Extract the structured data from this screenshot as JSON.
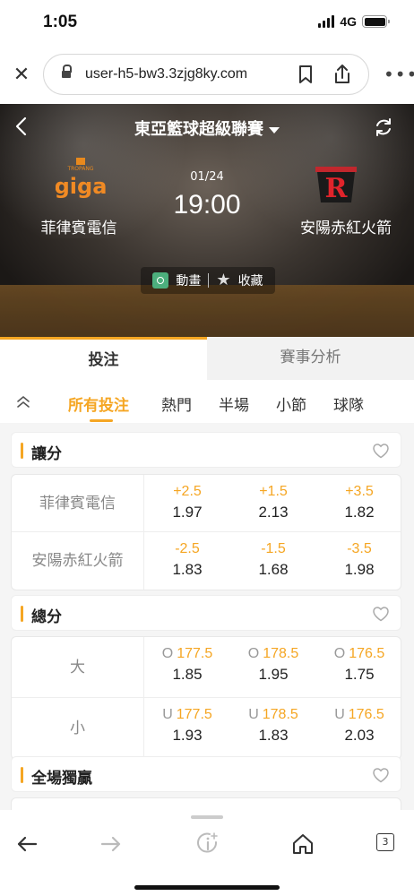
{
  "status_bar": {
    "time": "1:05",
    "network": "4G"
  },
  "browser": {
    "url": "user-h5-bw3.3zjg8ky.com",
    "tab_count": "3"
  },
  "match": {
    "league": "東亞籃球超級聯賽",
    "date": "01/24",
    "time": "19:00",
    "home_team": "菲律賓電信",
    "away_team": "安陽赤紅火箭",
    "home_logo_text": "giga",
    "home_logo_subtext": "TROPANG",
    "away_logo_text": "R",
    "animation_label": "動畫",
    "favorite_label": "收藏"
  },
  "main_tabs": [
    {
      "label": "投注",
      "active": true
    },
    {
      "label": "賽事分析",
      "active": false
    }
  ],
  "sub_tabs": [
    {
      "label": "所有投注",
      "active": true
    },
    {
      "label": "熱門"
    },
    {
      "label": "半場"
    },
    {
      "label": "小節"
    },
    {
      "label": "球隊"
    }
  ],
  "sections": [
    {
      "title": "讓分",
      "rows": [
        {
          "label": "菲律賓電信",
          "cells": [
            {
              "prefix": "",
              "handicap": "+2.5",
              "odds": "1.97"
            },
            {
              "prefix": "",
              "handicap": "+1.5",
              "odds": "2.13"
            },
            {
              "prefix": "",
              "handicap": "+3.5",
              "odds": "1.82"
            }
          ]
        },
        {
          "label": "安陽赤紅火箭",
          "cells": [
            {
              "prefix": "",
              "handicap": "-2.5",
              "odds": "1.83"
            },
            {
              "prefix": "",
              "handicap": "-1.5",
              "odds": "1.68"
            },
            {
              "prefix": "",
              "handicap": "-3.5",
              "odds": "1.98"
            }
          ]
        }
      ]
    },
    {
      "title": "總分",
      "rows": [
        {
          "label": "大",
          "cells": [
            {
              "prefix": "O",
              "handicap": "177.5",
              "odds": "1.85"
            },
            {
              "prefix": "O",
              "handicap": "178.5",
              "odds": "1.95"
            },
            {
              "prefix": "O",
              "handicap": "176.5",
              "odds": "1.75"
            }
          ]
        },
        {
          "label": "小",
          "cells": [
            {
              "prefix": "U",
              "handicap": "177.5",
              "odds": "1.93"
            },
            {
              "prefix": "U",
              "handicap": "178.5",
              "odds": "1.83"
            },
            {
              "prefix": "U",
              "handicap": "176.5",
              "odds": "2.03"
            }
          ]
        }
      ]
    },
    {
      "title": "全場獨贏",
      "rows": []
    }
  ],
  "colors": {
    "accent": "#f5a623",
    "odds": "#222222",
    "label": "#888888"
  }
}
